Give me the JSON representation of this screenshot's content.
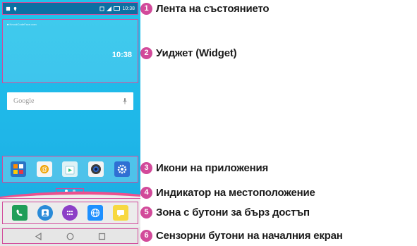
{
  "phone": {
    "status_bar": {
      "time": "10:38"
    },
    "widget": {
      "caption": "■ KnockCodeFace.com",
      "clock": "10:38"
    },
    "search": {
      "placeholder": "Google",
      "icon": "microphone-icon"
    },
    "apps": [
      {
        "name": "app-group-icon",
        "color": "#2a74c5"
      },
      {
        "name": "email-icon",
        "color": "#f5f5f5"
      },
      {
        "name": "play-store-icon",
        "color": "#e0f2f6"
      },
      {
        "name": "camera-icon",
        "color": "#f3f3f3"
      },
      {
        "name": "settings-icon",
        "color": "#2f6fd3"
      }
    ],
    "page_indicator": {
      "pages": 2,
      "current": 1
    },
    "dock": [
      {
        "name": "phone-icon",
        "color": "#1f9e59"
      },
      {
        "name": "contacts-icon",
        "color": "#2a8bd8"
      },
      {
        "name": "apps-drawer-icon",
        "color": "#8c3fc7"
      },
      {
        "name": "browser-icon",
        "color": "#1e90ff"
      },
      {
        "name": "messaging-icon",
        "color": "#f7d840"
      }
    ],
    "nav": [
      "back-icon",
      "home-icon",
      "recent-apps-icon"
    ]
  },
  "callouts": [
    {
      "number": "1",
      "label": "Лента на състоянието"
    },
    {
      "number": "2",
      "label": "Уиджет (Widget)"
    },
    {
      "number": "3",
      "label": "Икони на приложения"
    },
    {
      "number": "4",
      "label": "Индикатор на местоположение"
    },
    {
      "number": "5",
      "label": "Зона с бутони за бърз достъп"
    },
    {
      "number": "6",
      "label": "Сензорни бутони на началния екран"
    }
  ],
  "accent_color": "#d24a9a"
}
